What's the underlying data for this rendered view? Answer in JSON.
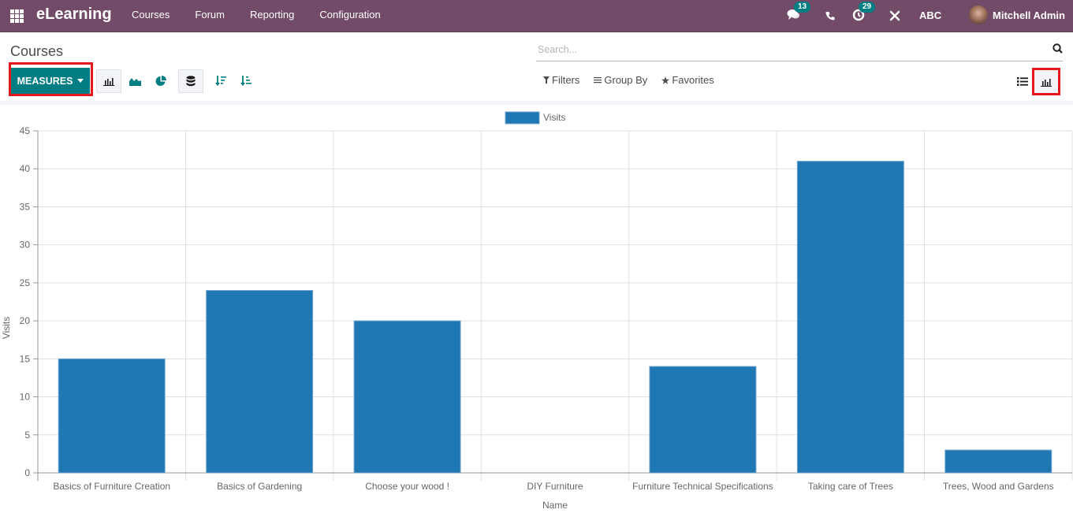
{
  "navbar": {
    "app_name": "eLearning",
    "menu": [
      "Courses",
      "Forum",
      "Reporting",
      "Configuration"
    ],
    "messages_badge": "13",
    "activities_badge": "29",
    "company": "ABC",
    "user": "Mitchell Admin"
  },
  "control_panel": {
    "title": "Courses",
    "measures_label": "MEASURES",
    "search_placeholder": "Search...",
    "filters_label": "Filters",
    "group_by_label": "Group By",
    "favorites_label": "Favorites"
  },
  "colors": {
    "navbar": "#714b67",
    "primary": "#017e84",
    "bar": "#1f77b4",
    "highlight": "#e3191e"
  },
  "chart_data": {
    "type": "bar",
    "title": "",
    "xlabel": "Name",
    "ylabel": "Visits",
    "legend": [
      "Visits"
    ],
    "legend_position": "top-center",
    "grid": true,
    "ylim": [
      0,
      45
    ],
    "yticks": [
      0,
      5,
      10,
      15,
      20,
      25,
      30,
      35,
      40,
      45
    ],
    "categories": [
      "Basics of Furniture Creation",
      "Basics of Gardening",
      "Choose your wood !",
      "DIY Furniture",
      "Furniture Technical Specifications",
      "Taking care of Trees",
      "Trees, Wood and Gardens"
    ],
    "series": [
      {
        "name": "Visits",
        "values": [
          15,
          24,
          20,
          0,
          14,
          41,
          3
        ]
      }
    ]
  }
}
